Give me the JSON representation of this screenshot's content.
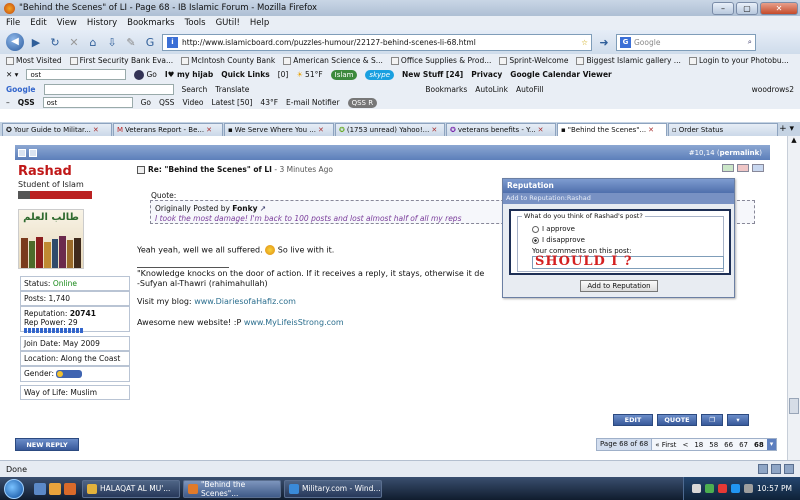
{
  "window": {
    "title": "\"Behind the Scenes\" of LI - Page 68 - IB Islamic Forum - Mozilla Firefox"
  },
  "menu": [
    "File",
    "Edit",
    "View",
    "History",
    "Bookmarks",
    "Tools",
    "GUtil!",
    "Help"
  ],
  "nav": {
    "url": "http://www.islamicboard.com/puzzles-humour/22127-behind-scenes-li-68.html",
    "search_placeholder": "Google"
  },
  "bookmarks": [
    "Most Visited",
    "First Security Bank Eva...",
    "McIntosh County Bank",
    "American Science & S...",
    "Office Supplies & Prod...",
    "Sprint-Welcome",
    "Biggest Islamic gallery ...",
    "Login to your Photobu..."
  ],
  "toolbar1": {
    "search_value": "ost",
    "go": "Go",
    "myhijab": "I♥ my hijab",
    "quicklinks": "Quick Links",
    "count": "[0]",
    "temp": "51°F",
    "islam": "Islam",
    "skype": "skype",
    "newstuff": "New Stuff [24]",
    "privacy": "Privacy",
    "gcal": "Google Calendar Viewer"
  },
  "toolbar2": {
    "google": "Google",
    "search": "Search",
    "translate": "Translate",
    "bookmarks": "Bookmarks",
    "autolink": "AutoLink",
    "autofill": "AutoFill",
    "user": "woodrows2"
  },
  "toolbar3": {
    "qss": "QSS",
    "value": "ost",
    "go": "Go",
    "qss2": "QSS",
    "video": "Video",
    "latest": "Latest [50]",
    "temp": "43°F",
    "notifier": "E-mail Notifier",
    "qssr": "QSS R"
  },
  "tabs": [
    {
      "label": "Your Guide to Militar..."
    },
    {
      "label": "Veterans Report - Be..."
    },
    {
      "label": "We Serve Where You ..."
    },
    {
      "label": "(1753 unread) Yahoo!..."
    },
    {
      "label": "veterans benefits - Y..."
    },
    {
      "label": "\"Behind the Scenes\"..."
    },
    {
      "label": "Order Status"
    }
  ],
  "post": {
    "number": "#10,14",
    "permalink": "permalink",
    "username": "Rashad",
    "user_title": "Student of Islam",
    "avatar_text": "طالب العلم",
    "status_label": "Status:",
    "status_value": "Online",
    "posts": "Posts: 1,740",
    "rep_label": "Reputation:",
    "rep_value": "20741",
    "rep_power": "Rep Power: 29",
    "join_date": "Join Date: May 2009",
    "location": "Location: Along the Coast",
    "gender_label": "Gender:",
    "way_of_life": "Way of Life: Muslim",
    "title": "Re: \"Behind the Scenes\" of LI",
    "time": "- 3 Minutes Ago",
    "quote_label": "Quote:",
    "quote_by_prefix": "Originally Posted by",
    "quote_author": "Fonky",
    "quote_text": "I took the most damage! I'm back to 100 posts and lost almost half of all my reps",
    "line1a": "Yeah yeah, well we all suffered.",
    "line1b": "So live with it.",
    "sig1": "\"Knowledge knocks on the door of action. If it receives a reply, it stays, otherwise it de",
    "sig2": "-Sufyan al-Thawri (rahimahullah)",
    "blog_label": "Visit my blog:",
    "blog_link": "www.DiariesofaHafiz.com",
    "site_label": "Awesome new website! :P",
    "site_link": "www.MyLifeisStrong.com",
    "btn_edit": "EDIT",
    "btn_quote": "QUOTE"
  },
  "new_reply": "NEW REPLY",
  "pagenav": {
    "page": "Page 68 of 68",
    "first": "« First",
    "prev": "<",
    "pages": [
      "18",
      "58",
      "66",
      "67"
    ],
    "current": "68"
  },
  "reputation": {
    "title": "Reputation",
    "add_to": "Add to Reputation:",
    "add_to_user": "Rashad",
    "question": "What do you think of Rashad's post?",
    "approve": "I approve",
    "disapprove": "I disapprove",
    "comments_label": "Your comments on this post:",
    "comment_value": "SHOULD I ?",
    "submit": "Add to Reputation"
  },
  "status": {
    "text": "Done"
  },
  "taskbar": {
    "tasks": [
      "HALAQAT AL MU'...",
      "\"Behind the Scenes\"...",
      "Military.com - Wind..."
    ],
    "clock": "10:57 PM"
  },
  "colors": {
    "username": "#c01818",
    "online": "#1a8a1a",
    "quote_text": "#7a3d9b",
    "link": "#2b6e8e",
    "post_header": "#5c7fba",
    "comment_red": "#d42020"
  }
}
